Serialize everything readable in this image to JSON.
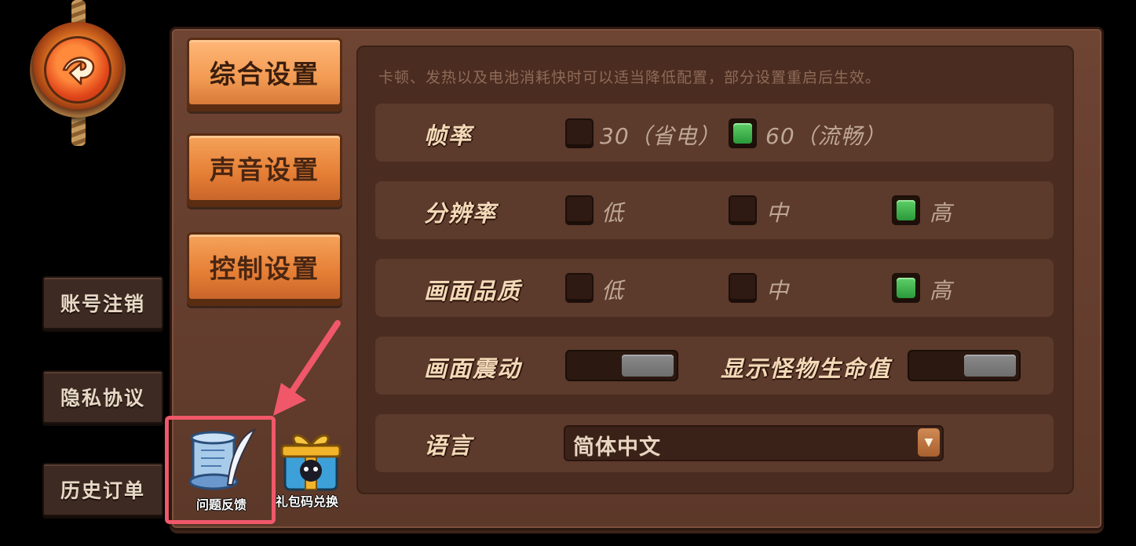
{
  "tabs": [
    {
      "label": "综合设置",
      "active": true
    },
    {
      "label": "声音设置",
      "active": false
    },
    {
      "label": "控制设置",
      "active": false
    }
  ],
  "side_buttons": [
    "账号注销",
    "隐私协议",
    "历史订单"
  ],
  "hint": "卡顿、发热以及电池消耗快时可以适当降低配置，部分设置重启后生效。",
  "settings": {
    "frame_rate": {
      "label": "帧率",
      "options": [
        "30（省电）",
        "60（流畅）"
      ],
      "selected": "60（流畅）"
    },
    "resolution": {
      "label": "分辨率",
      "options": [
        "低",
        "中",
        "高"
      ],
      "selected": "高"
    },
    "quality": {
      "label": "画面品质",
      "options": [
        "低",
        "中",
        "高"
      ],
      "selected": "高"
    },
    "shake": {
      "label": "画面震动",
      "value": "off"
    },
    "monster_hp": {
      "label": "显示怪物生命值",
      "value": "off"
    },
    "language": {
      "label": "语言",
      "value": "简体中文"
    }
  },
  "bottom_icons": {
    "feedback": "问题反馈",
    "gift": "礼包码兑换"
  },
  "colors": {
    "annotation": "#f0586a",
    "checked": "#3fb54e",
    "tab": "#f29a52"
  }
}
